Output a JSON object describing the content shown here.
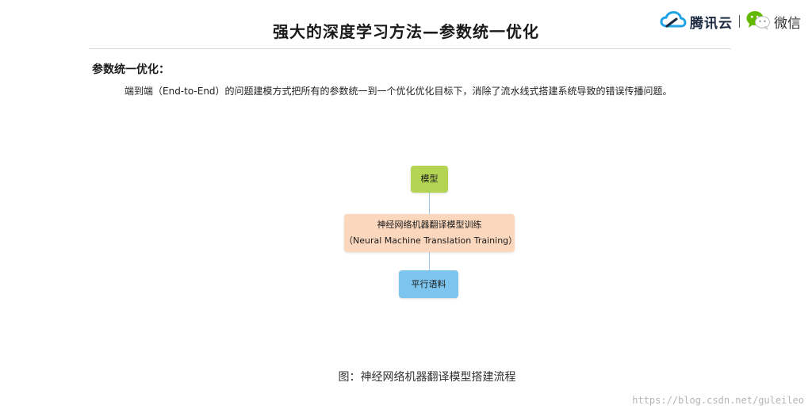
{
  "header": {
    "title": "强大的深度学习方法—参数统一优化",
    "brand": {
      "tencent_cloud_name": "腾讯云",
      "wechat_name": "微信",
      "tencent_cloud_icon": "tencent-cloud-logo-icon",
      "wechat_icon": "wechat-logo-icon",
      "colors": {
        "tencent_blue": "#1ea4e5",
        "tencent_navy": "#1b2a41",
        "wechat_green": "#62b900"
      }
    }
  },
  "section": {
    "heading": "参数统一优化：",
    "body": "端到端（End-to-End）的问题建模方式把所有的参数统一到一个优化优化目标下，消除了流水线式搭建系统导致的错误传播问题。"
  },
  "diagram": {
    "nodes": {
      "model": {
        "label": "模型",
        "color": "#b4d454"
      },
      "nmt_training": {
        "label_zh": "神经网络机器翻译模型训练",
        "label_en": "（Neural Machine Translation Training）",
        "color": "#fbd7bd"
      },
      "parallel_corpus": {
        "label": "平行语料",
        "color": "#7dc5ee"
      }
    },
    "connector_color": "#9ec9e6",
    "caption": "图：神经网络机器翻译模型搭建流程"
  },
  "watermark": {
    "text": "https://blog.csdn.net/guleileo"
  }
}
